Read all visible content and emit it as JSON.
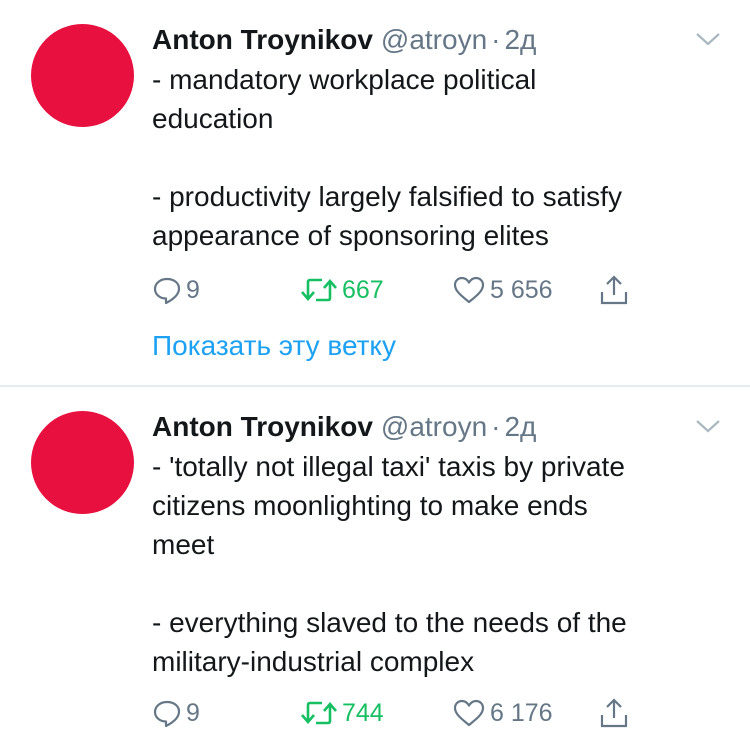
{
  "colors": {
    "avatar": "#e8103e",
    "link": "#1da1f2",
    "retweet": "#17bf63",
    "muted": "#657786"
  },
  "tweets": [
    {
      "name": "Anton Troynikov",
      "handle": "@atroyn",
      "dot": "·",
      "time": "2д",
      "text": "- mandatory workplace political\neducation\n\n- productivity largely falsified to satisfy\nappearance of sponsoring elites",
      "replies": "9",
      "retweets": "667",
      "likes": "5 656",
      "show_thread": "Показать эту ветку"
    },
    {
      "name": "Anton Troynikov",
      "handle": "@atroyn",
      "dot": "·",
      "time": "2д",
      "text": "- 'totally not illegal taxi' taxis by private\ncitizens moonlighting to make ends\nmeet\n\n- everything slaved to the needs of the\nmilitary-industrial complex",
      "replies": "9",
      "retweets": "744",
      "likes": "6 176"
    }
  ],
  "icons": [
    "reply-icon",
    "retweet-icon",
    "like-icon",
    "share-icon",
    "chevron-down-icon"
  ]
}
